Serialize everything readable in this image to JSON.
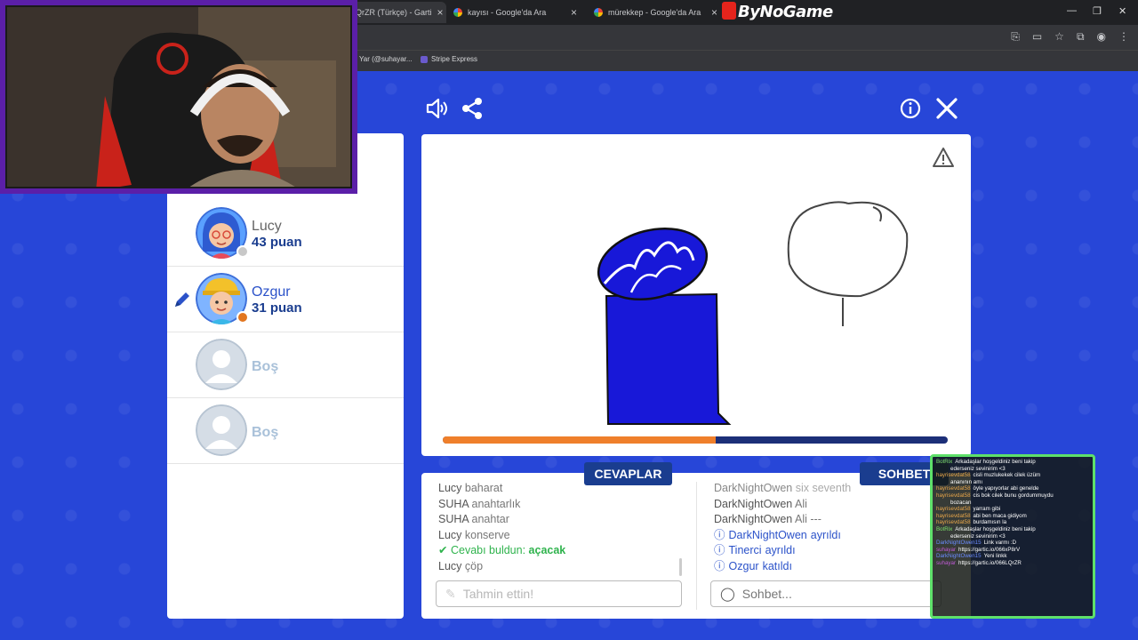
{
  "browser": {
    "tabs": [
      {
        "title": "QrZR (Türkçe) - Garti",
        "active": true
      },
      {
        "title": "kayısı - Google'da Ara",
        "active": false
      },
      {
        "title": "mürekkep - Google'da Ara",
        "active": false
      }
    ],
    "tab_close": "×",
    "brand": "ByNoGame",
    "bookmarks": [
      "Yar (@suhayar...",
      "Stripe Express"
    ]
  },
  "players": [
    {
      "name": "Lucy",
      "score": "43 puan",
      "status_color": "#c8c8c8",
      "avatar": "lucy"
    },
    {
      "name": "Ozgur",
      "score": "31 puan",
      "status_color": "#e2761f",
      "avatar": "ozgur",
      "drawing": true
    },
    {
      "name": "Boş",
      "avatar": "empty"
    },
    {
      "name": "Boş",
      "avatar": "empty"
    }
  ],
  "canvas": {
    "progress": 0.54
  },
  "answers": {
    "header": "CEVAPLAR",
    "messages": [
      {
        "user": "Lucy",
        "text": "baharat"
      },
      {
        "user": "SUHA",
        "text": "anahtarlık"
      },
      {
        "user": "SUHA",
        "text": "anahtar"
      },
      {
        "user": "Lucy",
        "text": "konserve"
      }
    ],
    "correct_prefix": "Cevabı buldun:",
    "correct_answer": "açacak",
    "last": {
      "user": "Lucy",
      "text": "çöp"
    },
    "input_placeholder": "Tahmin ettin!"
  },
  "chat": {
    "header": "SOHBET",
    "messages": [
      {
        "user": "DarkNightOwen",
        "text": "six seventh"
      },
      {
        "user": "DarkNightOwen",
        "text": "Ali"
      },
      {
        "user": "DarkNightOwen",
        "text": "Ali ---"
      }
    ],
    "system": [
      {
        "user": "DarkNightOwen",
        "text": "ayrıldı"
      },
      {
        "user": "Tinerci",
        "text": "ayrıldı"
      },
      {
        "user": "Ozgur",
        "text": "katıldı"
      }
    ],
    "input_placeholder": "Sohbet..."
  },
  "stream_chat": [
    {
      "user": "BotRix",
      "text": "Arkadaşlar hoşgeldiniz beni takip",
      "color": "#7ee06a"
    },
    {
      "user": "",
      "text": "ederseniz sevinirim <3",
      "color": "#7ee06a"
    },
    {
      "user": "hayrisevdat58",
      "text": "cisli muzlukekek cilek üzüm",
      "color": "#e8a64a"
    },
    {
      "user": "",
      "text": "ananının amı",
      "color": "#e8a64a"
    },
    {
      "user": "hayrisevdat58",
      "text": "öyle yapıyorlar abi genelde",
      "color": "#e8a64a"
    },
    {
      "user": "hayrisevdat58",
      "text": "cis bok cilek bunu gordummuydu",
      "color": "#e8a64a"
    },
    {
      "user": "",
      "text": "bozacan",
      "color": "#e8a64a"
    },
    {
      "user": "hayrisevdat58",
      "text": "yarram gibi",
      "color": "#e8a64a"
    },
    {
      "user": "hayrisevdat58",
      "text": "abi ben maca gidiyom",
      "color": "#e8a64a"
    },
    {
      "user": "hayrisevdat58",
      "text": "burdamısın la",
      "color": "#e8a64a"
    },
    {
      "user": "BotRix",
      "text": "Arkadaşlar hoşgeldiniz beni takip",
      "color": "#7ee06a"
    },
    {
      "user": "",
      "text": "ederseniz sevinirim <3",
      "color": "#7ee06a"
    },
    {
      "user": "DarkNightOwen15",
      "text": "Link varmı :D",
      "color": "#6b8cff"
    },
    {
      "user": "suhayar",
      "text": "https://gartic.io/066xP8rV",
      "color": "#c05ad6"
    },
    {
      "user": "DarkNightOwen15",
      "text": "Yeni linkk",
      "color": "#6b8cff"
    },
    {
      "user": "suhayar",
      "text": "https://gartic.io/066LQrZR",
      "color": "#c05ad6"
    }
  ]
}
